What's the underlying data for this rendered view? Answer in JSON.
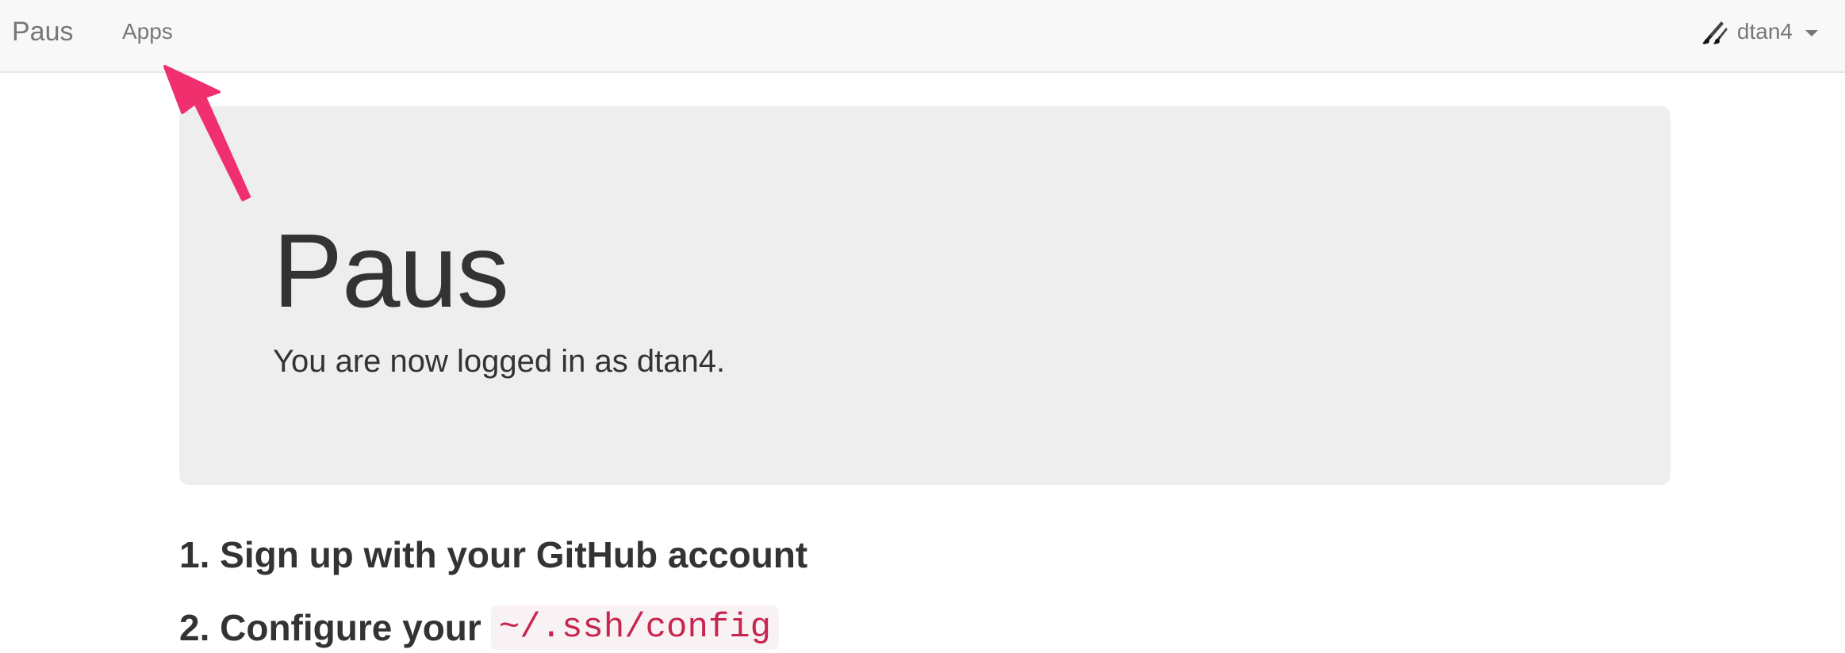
{
  "navbar": {
    "brand": "Paus",
    "links": [
      {
        "label": "Apps"
      }
    ],
    "user": {
      "name": "dtan4",
      "avatar_icon": "user-avatar-icon",
      "dropdown_icon": "caret-down-icon"
    }
  },
  "jumbotron": {
    "title": "Paus",
    "lead": "You are now logged in as dtan4."
  },
  "steps": [
    {
      "label": "1. Sign up with your GitHub account"
    },
    {
      "label": "2. Configure your",
      "code": "~/.ssh/config"
    }
  ],
  "annotation": {
    "arrow_color": "#f0306e",
    "icon": "pointer-arrow-icon"
  },
  "colors": {
    "navbar_bg": "#f8f8f8",
    "jumbotron_bg": "#eeeeee",
    "code_text": "#c7254e",
    "code_bg": "#f9f2f4"
  }
}
